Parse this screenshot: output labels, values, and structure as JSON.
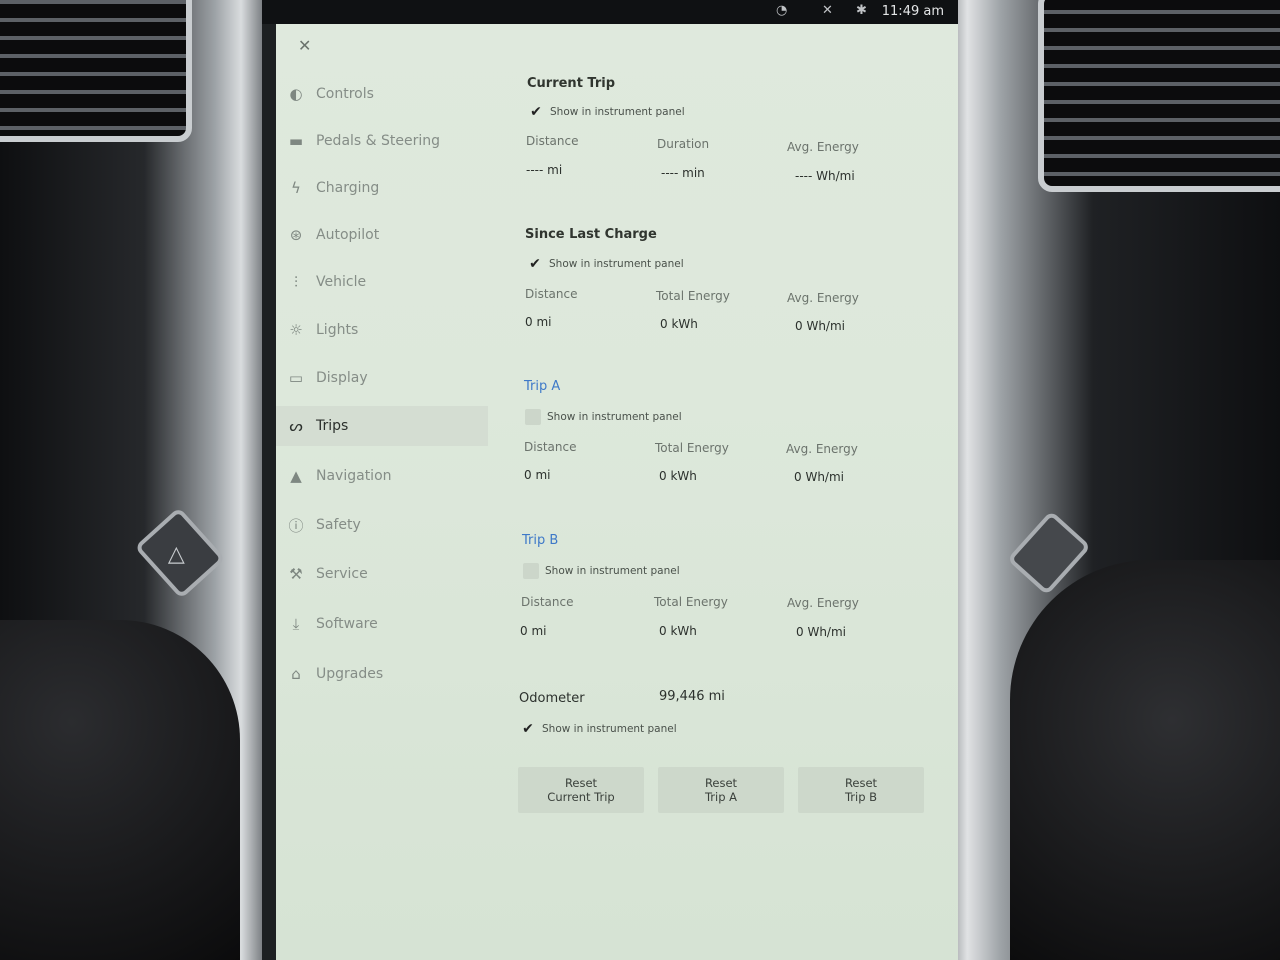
{
  "status": {
    "time": "11:49 am"
  },
  "nav": [
    {
      "label": "Controls",
      "icon": "toggle-icon"
    },
    {
      "label": "Pedals & Steering",
      "icon": "car-icon"
    },
    {
      "label": "Charging",
      "icon": "lightning-icon"
    },
    {
      "label": "Autopilot",
      "icon": "steering-wheel-icon"
    },
    {
      "label": "Vehicle",
      "icon": "sliders-icon"
    },
    {
      "label": "Lights",
      "icon": "sun-icon"
    },
    {
      "label": "Display",
      "icon": "display-icon"
    },
    {
      "label": "Trips",
      "icon": "trips-icon"
    },
    {
      "label": "Navigation",
      "icon": "navigation-arrow-icon"
    },
    {
      "label": "Safety",
      "icon": "safety-icon"
    },
    {
      "label": "Service",
      "icon": "wrench-icon"
    },
    {
      "label": "Software",
      "icon": "download-icon"
    },
    {
      "label": "Upgrades",
      "icon": "bag-icon"
    }
  ],
  "current_trip": {
    "title": "Current Trip",
    "show": "Show in instrument panel",
    "h1": "Distance",
    "h2": "Duration",
    "h3": "Avg. Energy",
    "v1": "---- mi",
    "v2": "---- min",
    "v3": "---- Wh/mi"
  },
  "since_last_charge": {
    "title": "Since Last Charge",
    "show": "Show in instrument panel",
    "h1": "Distance",
    "h2": "Total Energy",
    "h3": "Avg. Energy",
    "v1": "0 mi",
    "v2": "0 kWh",
    "v3": "0 Wh/mi"
  },
  "trip_a": {
    "title": "Trip A",
    "show": "Show in instrument panel",
    "h1": "Distance",
    "h2": "Total Energy",
    "h3": "Avg. Energy",
    "v1": "0 mi",
    "v2": "0 kWh",
    "v3": "0 Wh/mi"
  },
  "trip_b": {
    "title": "Trip B",
    "show": "Show in instrument panel",
    "h1": "Distance",
    "h2": "Total Energy",
    "h3": "Avg. Energy",
    "v1": "0 mi",
    "v2": "0 kWh",
    "v3": "0 Wh/mi"
  },
  "odometer": {
    "label": "Odometer",
    "value": "99,446 mi",
    "show": "Show in instrument panel"
  },
  "buttons": {
    "reset_current": [
      "Reset",
      "Current Trip"
    ],
    "reset_a": [
      "Reset",
      "Trip A"
    ],
    "reset_b": [
      "Reset",
      "Trip B"
    ]
  }
}
